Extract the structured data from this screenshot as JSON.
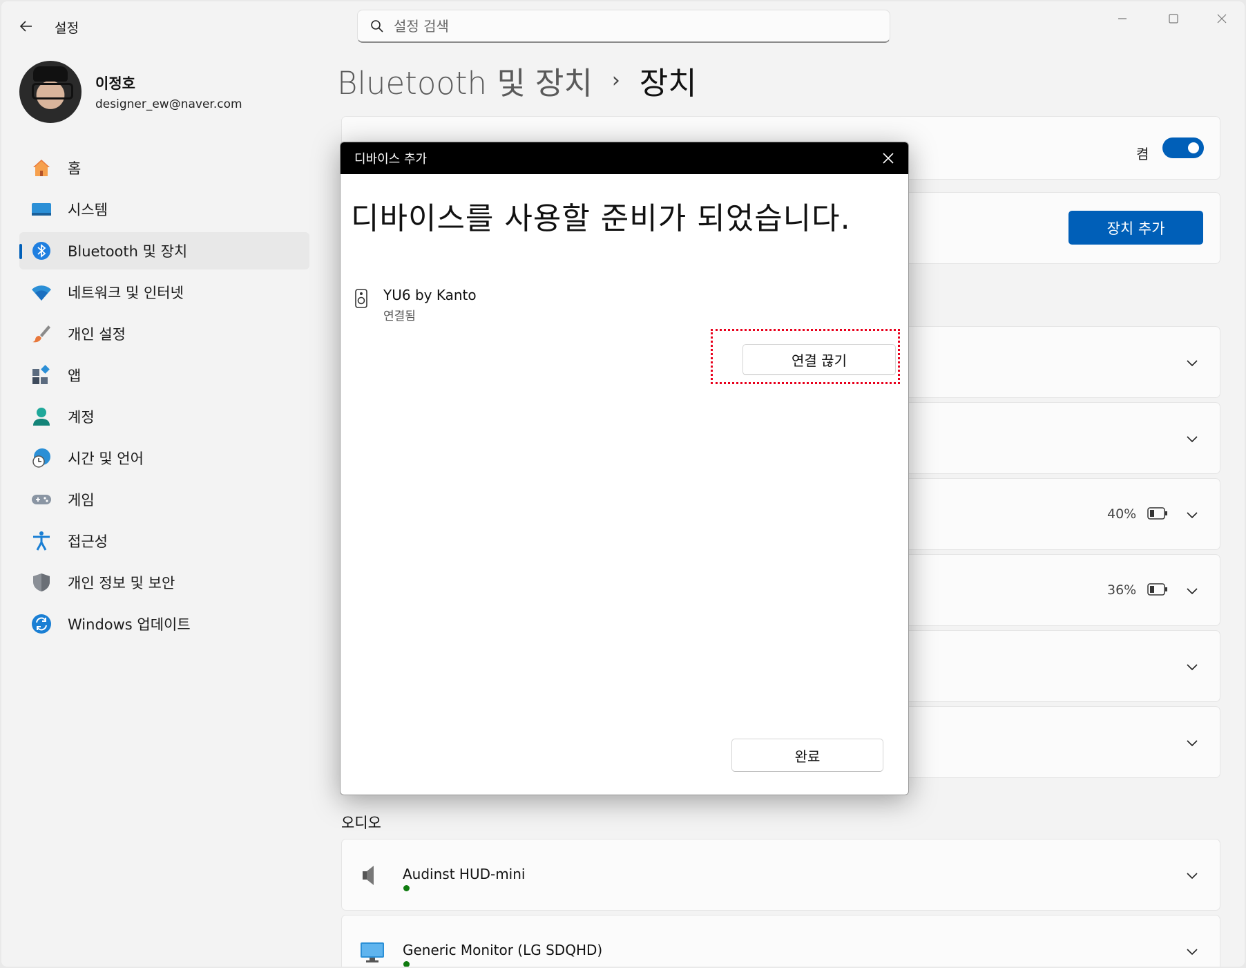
{
  "window": {
    "app_title": "설정",
    "search_placeholder": "설정 검색"
  },
  "profile": {
    "name": "이정호",
    "email": "designer_ew@naver.com"
  },
  "nav": {
    "items": [
      {
        "label": "홈",
        "icon": "home-icon"
      },
      {
        "label": "시스템",
        "icon": "system-icon"
      },
      {
        "label": "Bluetooth 및 장치",
        "icon": "bluetooth-icon",
        "active": true
      },
      {
        "label": "네트워크 및 인터넷",
        "icon": "wifi-icon"
      },
      {
        "label": "개인 설정",
        "icon": "brush-icon"
      },
      {
        "label": "앱",
        "icon": "apps-icon"
      },
      {
        "label": "계정",
        "icon": "account-icon"
      },
      {
        "label": "시간 및 언어",
        "icon": "globe-clock-icon"
      },
      {
        "label": "게임",
        "icon": "gamepad-icon"
      },
      {
        "label": "접근성",
        "icon": "accessibility-icon"
      },
      {
        "label": "개인 정보 및 보안",
        "icon": "shield-icon"
      },
      {
        "label": "Windows 업데이트",
        "icon": "update-icon"
      }
    ]
  },
  "breadcrumb": {
    "parent": "Bluetooth 및 장치",
    "separator": "›",
    "current": "장치"
  },
  "main": {
    "bluetooth_toggle_label": "켬",
    "add_device_label": "장치 추가",
    "battery_1": "40%",
    "battery_2": "36%",
    "audio_section_title": "오디오",
    "audio_devices": [
      {
        "name": "Audinst HUD-mini",
        "icon": "speaker-icon"
      },
      {
        "name": "Generic Monitor (LG SDQHD)",
        "icon": "monitor-icon"
      }
    ]
  },
  "dialog": {
    "title": "디바이스 추가",
    "heading": "디바이스를 사용할 준비가 되었습니다.",
    "device_name": "YU6 by Kanto",
    "device_status": "연결됨",
    "disconnect_label": "연결 끊기",
    "done_label": "완료"
  },
  "colors": {
    "accent": "#005fb8",
    "highlight": "#e8001c",
    "status_green": "#0f7b0f"
  }
}
